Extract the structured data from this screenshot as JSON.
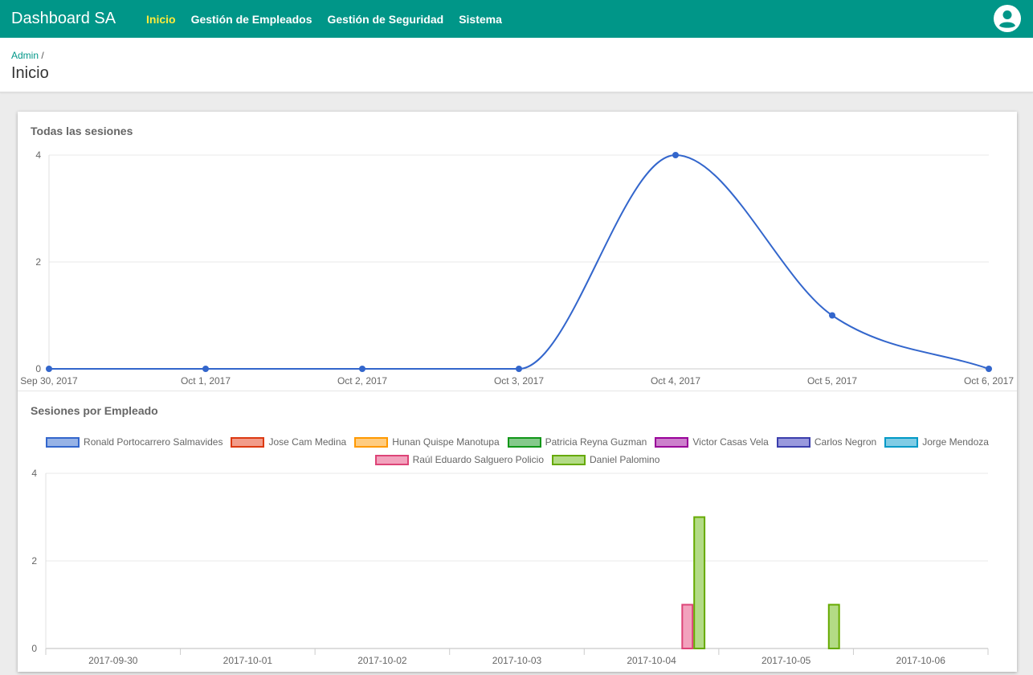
{
  "header": {
    "brand": "Dashboard SA",
    "nav": [
      {
        "label": "Inicio",
        "active": true
      },
      {
        "label": "Gestión de Empleados",
        "active": false
      },
      {
        "label": "Gestión de Seguridad",
        "active": false
      },
      {
        "label": "Sistema",
        "active": false
      }
    ],
    "account_icon": "account-circle-icon"
  },
  "breadcrumb": {
    "link": "Admin",
    "separator": "/"
  },
  "page_title": "Inicio",
  "colors": {
    "primary": "#009688",
    "active_nav": "#ffeb3b",
    "line": "#3366cc"
  },
  "charts": {
    "sessions_title": "Todas las sesiones",
    "employee_title": "Sesiones por Empleado"
  },
  "chart_data": [
    {
      "type": "line",
      "title": "Todas las sesiones",
      "x": [
        "Sep 30, 2017",
        "Oct 1, 2017",
        "Oct 2, 2017",
        "Oct 3, 2017",
        "Oct 4, 2017",
        "Oct 5, 2017",
        "Oct 6, 2017"
      ],
      "series": [
        {
          "values": [
            0,
            0,
            0,
            0,
            4,
            1,
            0
          ],
          "color": "#3366cc"
        }
      ],
      "ylim": [
        0,
        4
      ],
      "yticks": [
        0,
        2,
        4
      ],
      "grid": true
    },
    {
      "type": "bar",
      "title": "Sesiones por Empleado",
      "categories": [
        "2017-09-30",
        "2017-10-01",
        "2017-10-02",
        "2017-10-03",
        "2017-10-04",
        "2017-10-05",
        "2017-10-06"
      ],
      "series": [
        {
          "name": "Ronald Portocarrero Salmavides",
          "fill": "#97b3e6",
          "border": "#3366cc",
          "values": [
            0,
            0,
            0,
            0,
            0,
            0,
            0
          ]
        },
        {
          "name": "Jose Cam Medina",
          "fill": "#f29c8a",
          "border": "#dc3912",
          "values": [
            0,
            0,
            0,
            0,
            0,
            0,
            0
          ]
        },
        {
          "name": "Hunan Quispe Manotupa",
          "fill": "#ffcc80",
          "border": "#ff9900",
          "values": [
            0,
            0,
            0,
            0,
            0,
            0,
            0
          ]
        },
        {
          "name": "Patricia Reyna Guzman",
          "fill": "#85c98b",
          "border": "#109618",
          "values": [
            0,
            0,
            0,
            0,
            0,
            0,
            0
          ]
        },
        {
          "name": "Victor Casas Vela",
          "fill": "#cc80cc",
          "border": "#990099",
          "values": [
            0,
            0,
            0,
            0,
            0,
            0,
            0
          ]
        },
        {
          "name": "Carlos Negron",
          "fill": "#9999dd",
          "border": "#3b3eac",
          "values": [
            0,
            0,
            0,
            0,
            0,
            0,
            0
          ]
        },
        {
          "name": "Jorge Mendoza",
          "fill": "#80cce5",
          "border": "#0099c6",
          "values": [
            0,
            0,
            0,
            0,
            0,
            0,
            0
          ]
        },
        {
          "name": "Raúl Eduardo Salguero Policio",
          "fill": "#f2a2bd",
          "border": "#dd4477",
          "values": [
            0,
            0,
            0,
            0,
            1,
            0,
            0
          ]
        },
        {
          "name": "Daniel Palomino",
          "fill": "#b3db86",
          "border": "#66aa00",
          "values": [
            0,
            0,
            0,
            0,
            3,
            1,
            0
          ]
        }
      ],
      "ylim": [
        0,
        4
      ],
      "yticks": [
        0,
        2,
        4
      ],
      "legend": "top",
      "grid": true
    }
  ]
}
